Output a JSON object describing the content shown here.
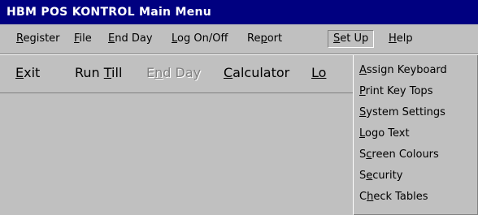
{
  "window": {
    "title": "HBM POS KONTROL Main Menu"
  },
  "menubar": {
    "items": [
      {
        "pre": "",
        "key": "R",
        "post": "egister"
      },
      {
        "pre": "",
        "key": "F",
        "post": "ile"
      },
      {
        "pre": "",
        "key": "E",
        "post": "nd Day"
      },
      {
        "pre": "",
        "key": "L",
        "post": "og On/Off"
      },
      {
        "pre": "Re",
        "key": "p",
        "post": "ort"
      },
      {
        "pre": "",
        "key": "S",
        "post": "et Up"
      },
      {
        "pre": "",
        "key": "H",
        "post": "elp"
      }
    ]
  },
  "toolbar": {
    "items": [
      {
        "pre": "",
        "key": "E",
        "post": "xit"
      },
      {
        "pre": "Run ",
        "key": "T",
        "post": "ill"
      },
      {
        "pre": "E",
        "key": "n",
        "post": "d Day"
      },
      {
        "pre": "",
        "key": "C",
        "post": "alculator"
      },
      {
        "pre": "",
        "key": "Lo",
        "post": ""
      }
    ]
  },
  "setup_menu": {
    "items": [
      {
        "pre": "",
        "key": "A",
        "post": "ssign Keyboard"
      },
      {
        "pre": "",
        "key": "P",
        "post": "rint Key Tops"
      },
      {
        "pre": "",
        "key": "S",
        "post": "ystem Settings"
      },
      {
        "pre": "",
        "key": "L",
        "post": "ogo Text"
      },
      {
        "pre": "S",
        "key": "c",
        "post": "reen Colours"
      },
      {
        "pre": "S",
        "key": "e",
        "post": "curity"
      },
      {
        "pre": "C",
        "key": "h",
        "post": "eck Tables"
      }
    ]
  }
}
